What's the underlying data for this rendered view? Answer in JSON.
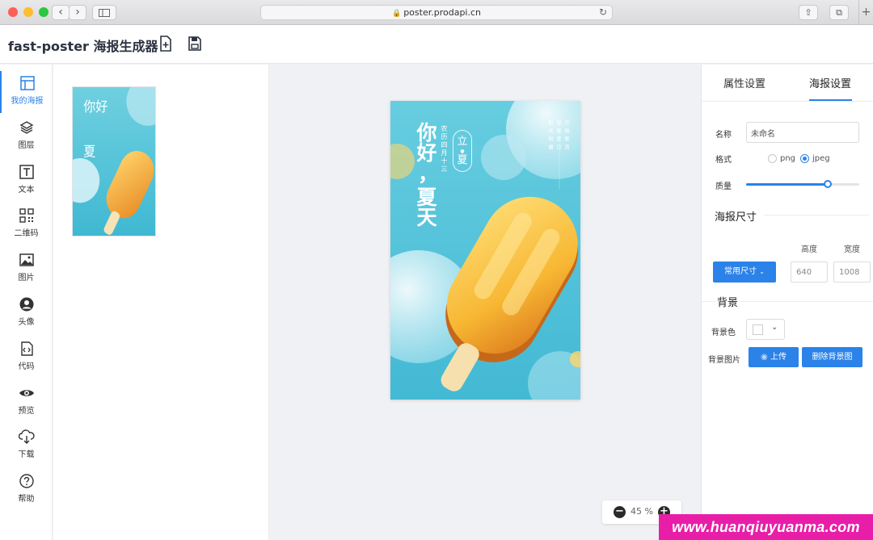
{
  "browser": {
    "url": "poster.prodapi.cn"
  },
  "app": {
    "title": "fast-poster 海报生成器",
    "new_icon": "file-plus-icon",
    "save_icon": "save-icon"
  },
  "tools": [
    {
      "label": "我的海报",
      "icon": "layout-icon",
      "active": true
    },
    {
      "label": "图层",
      "icon": "layers-icon"
    },
    {
      "label": "文本",
      "icon": "text-icon"
    },
    {
      "label": "二维码",
      "icon": "qrcode-icon"
    },
    {
      "label": "图片",
      "icon": "image-icon"
    },
    {
      "label": "头像",
      "icon": "avatar-icon"
    },
    {
      "label": "代码",
      "icon": "code-icon"
    },
    {
      "label": "预览",
      "icon": "eye-icon"
    },
    {
      "label": "下载",
      "icon": "download-icon"
    },
    {
      "label": "帮助",
      "icon": "help-icon"
    }
  ],
  "poster": {
    "headline_1": "你好",
    "headline_2": "，",
    "headline_3": "夏天",
    "badge_top": "立",
    "badge_bottom": "夏",
    "lunar_date": "农历四月十三",
    "side_text_1": "万物繁茂",
    "side_text_2": "迎接夏日",
    "side_text_3": "阳光明媚",
    "bg_color": "#4ec3d8",
    "popsicle_color": "#f7b733"
  },
  "zoom": {
    "value": "45 %"
  },
  "panel": {
    "tab_attr": "属性设置",
    "tab_poster": "海报设置",
    "name_label": "名称",
    "name_value": "未命名",
    "format_label": "格式",
    "format_png": "png",
    "format_jpeg": "jpeg",
    "format_selected": "jpeg",
    "quality_label": "质量",
    "quality_fraction": 0.72,
    "size_section": "海报尺寸",
    "height_label": "高度",
    "width_label": "宽度",
    "preset_button": "常用尺寸",
    "height_value": "640",
    "width_value": "1008",
    "bg_section": "背景",
    "bg_color_label": "背景色",
    "bg_image_label": "背景图片",
    "upload_button": "上传",
    "remove_bg_button": "删除背景图",
    "accent": "#2b82e8"
  },
  "watermark": "www.huanqiuyuanma.com"
}
